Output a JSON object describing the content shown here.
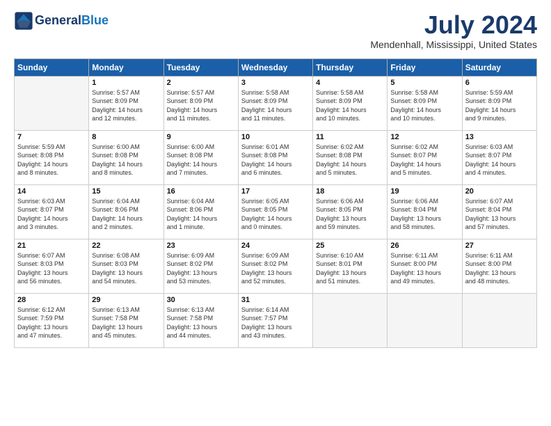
{
  "header": {
    "logo_line1": "General",
    "logo_line2": "Blue",
    "month_title": "July 2024",
    "location": "Mendenhall, Mississippi, United States"
  },
  "weekdays": [
    "Sunday",
    "Monday",
    "Tuesday",
    "Wednesday",
    "Thursday",
    "Friday",
    "Saturday"
  ],
  "weeks": [
    [
      {
        "num": "",
        "info": ""
      },
      {
        "num": "1",
        "info": "Sunrise: 5:57 AM\nSunset: 8:09 PM\nDaylight: 14 hours\nand 12 minutes."
      },
      {
        "num": "2",
        "info": "Sunrise: 5:57 AM\nSunset: 8:09 PM\nDaylight: 14 hours\nand 11 minutes."
      },
      {
        "num": "3",
        "info": "Sunrise: 5:58 AM\nSunset: 8:09 PM\nDaylight: 14 hours\nand 11 minutes."
      },
      {
        "num": "4",
        "info": "Sunrise: 5:58 AM\nSunset: 8:09 PM\nDaylight: 14 hours\nand 10 minutes."
      },
      {
        "num": "5",
        "info": "Sunrise: 5:58 AM\nSunset: 8:09 PM\nDaylight: 14 hours\nand 10 minutes."
      },
      {
        "num": "6",
        "info": "Sunrise: 5:59 AM\nSunset: 8:09 PM\nDaylight: 14 hours\nand 9 minutes."
      }
    ],
    [
      {
        "num": "7",
        "info": "Sunrise: 5:59 AM\nSunset: 8:08 PM\nDaylight: 14 hours\nand 8 minutes."
      },
      {
        "num": "8",
        "info": "Sunrise: 6:00 AM\nSunset: 8:08 PM\nDaylight: 14 hours\nand 8 minutes."
      },
      {
        "num": "9",
        "info": "Sunrise: 6:00 AM\nSunset: 8:08 PM\nDaylight: 14 hours\nand 7 minutes."
      },
      {
        "num": "10",
        "info": "Sunrise: 6:01 AM\nSunset: 8:08 PM\nDaylight: 14 hours\nand 6 minutes."
      },
      {
        "num": "11",
        "info": "Sunrise: 6:02 AM\nSunset: 8:08 PM\nDaylight: 14 hours\nand 5 minutes."
      },
      {
        "num": "12",
        "info": "Sunrise: 6:02 AM\nSunset: 8:07 PM\nDaylight: 14 hours\nand 5 minutes."
      },
      {
        "num": "13",
        "info": "Sunrise: 6:03 AM\nSunset: 8:07 PM\nDaylight: 14 hours\nand 4 minutes."
      }
    ],
    [
      {
        "num": "14",
        "info": "Sunrise: 6:03 AM\nSunset: 8:07 PM\nDaylight: 14 hours\nand 3 minutes."
      },
      {
        "num": "15",
        "info": "Sunrise: 6:04 AM\nSunset: 8:06 PM\nDaylight: 14 hours\nand 2 minutes."
      },
      {
        "num": "16",
        "info": "Sunrise: 6:04 AM\nSunset: 8:06 PM\nDaylight: 14 hours\nand 1 minute."
      },
      {
        "num": "17",
        "info": "Sunrise: 6:05 AM\nSunset: 8:05 PM\nDaylight: 14 hours\nand 0 minutes."
      },
      {
        "num": "18",
        "info": "Sunrise: 6:06 AM\nSunset: 8:05 PM\nDaylight: 13 hours\nand 59 minutes."
      },
      {
        "num": "19",
        "info": "Sunrise: 6:06 AM\nSunset: 8:04 PM\nDaylight: 13 hours\nand 58 minutes."
      },
      {
        "num": "20",
        "info": "Sunrise: 6:07 AM\nSunset: 8:04 PM\nDaylight: 13 hours\nand 57 minutes."
      }
    ],
    [
      {
        "num": "21",
        "info": "Sunrise: 6:07 AM\nSunset: 8:03 PM\nDaylight: 13 hours\nand 56 minutes."
      },
      {
        "num": "22",
        "info": "Sunrise: 6:08 AM\nSunset: 8:03 PM\nDaylight: 13 hours\nand 54 minutes."
      },
      {
        "num": "23",
        "info": "Sunrise: 6:09 AM\nSunset: 8:02 PM\nDaylight: 13 hours\nand 53 minutes."
      },
      {
        "num": "24",
        "info": "Sunrise: 6:09 AM\nSunset: 8:02 PM\nDaylight: 13 hours\nand 52 minutes."
      },
      {
        "num": "25",
        "info": "Sunrise: 6:10 AM\nSunset: 8:01 PM\nDaylight: 13 hours\nand 51 minutes."
      },
      {
        "num": "26",
        "info": "Sunrise: 6:11 AM\nSunset: 8:00 PM\nDaylight: 13 hours\nand 49 minutes."
      },
      {
        "num": "27",
        "info": "Sunrise: 6:11 AM\nSunset: 8:00 PM\nDaylight: 13 hours\nand 48 minutes."
      }
    ],
    [
      {
        "num": "28",
        "info": "Sunrise: 6:12 AM\nSunset: 7:59 PM\nDaylight: 13 hours\nand 47 minutes."
      },
      {
        "num": "29",
        "info": "Sunrise: 6:13 AM\nSunset: 7:58 PM\nDaylight: 13 hours\nand 45 minutes."
      },
      {
        "num": "30",
        "info": "Sunrise: 6:13 AM\nSunset: 7:58 PM\nDaylight: 13 hours\nand 44 minutes."
      },
      {
        "num": "31",
        "info": "Sunrise: 6:14 AM\nSunset: 7:57 PM\nDaylight: 13 hours\nand 43 minutes."
      },
      {
        "num": "",
        "info": ""
      },
      {
        "num": "",
        "info": ""
      },
      {
        "num": "",
        "info": ""
      }
    ]
  ]
}
